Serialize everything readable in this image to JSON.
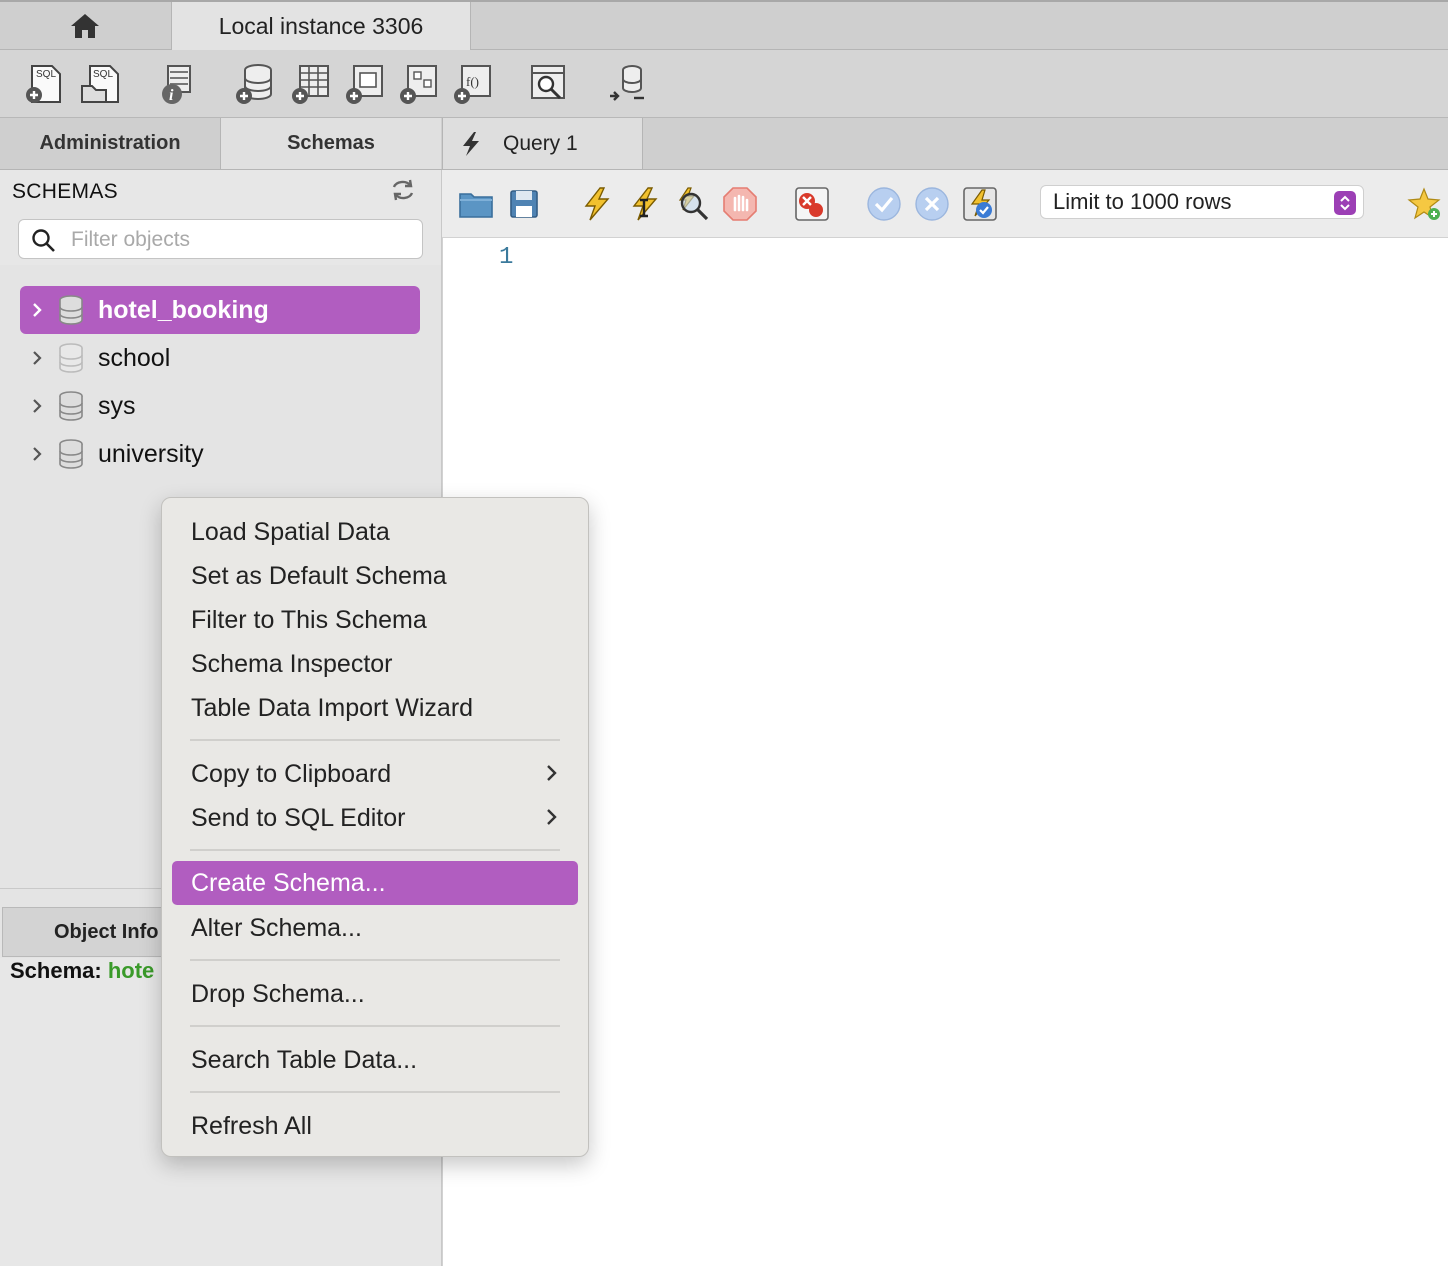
{
  "top_tabs": {
    "home_icon": "home-icon",
    "instance_label": "Local instance 3306"
  },
  "toolbar": {
    "icons": [
      "new-sql-tab-icon",
      "open-sql-file-icon",
      "info-icon",
      "create-schema-icon",
      "create-table-icon",
      "create-view-icon",
      "create-procedure-icon",
      "create-function-icon",
      "search-table-data-icon",
      "reconnect-icon"
    ]
  },
  "sidebar": {
    "tabs": [
      {
        "label": "Administration"
      },
      {
        "label": "Schemas"
      }
    ],
    "heading": "SCHEMAS",
    "filter_placeholder": "Filter objects",
    "schemas": [
      {
        "label": "hotel_booking",
        "selected": true
      },
      {
        "label": "school",
        "selected": false
      },
      {
        "label": "sys",
        "selected": false
      },
      {
        "label": "university",
        "selected": false
      }
    ],
    "object_info_tab": "Object Info",
    "schema_info_label": "Schema:",
    "schema_info_value": "hote"
  },
  "query": {
    "tab_label": "Query 1",
    "limit_label": "Limit to 1000 rows",
    "line_number": "1"
  },
  "context_menu": {
    "items": [
      {
        "label": "Load Spatial Data"
      },
      {
        "label": "Set as Default Schema"
      },
      {
        "label": "Filter to This Schema"
      },
      {
        "label": "Schema Inspector"
      },
      {
        "label": "Table Data Import Wizard"
      },
      {
        "label": "Copy to Clipboard",
        "submenu": true
      },
      {
        "label": "Send to SQL Editor",
        "submenu": true
      },
      {
        "label": "Create Schema...",
        "active": true
      },
      {
        "label": "Alter Schema..."
      },
      {
        "label": "Drop Schema..."
      },
      {
        "label": "Search Table Data..."
      },
      {
        "label": "Refresh All"
      }
    ]
  },
  "colors": {
    "accent": "#b15dc0",
    "info_green": "#3a9a2a"
  }
}
